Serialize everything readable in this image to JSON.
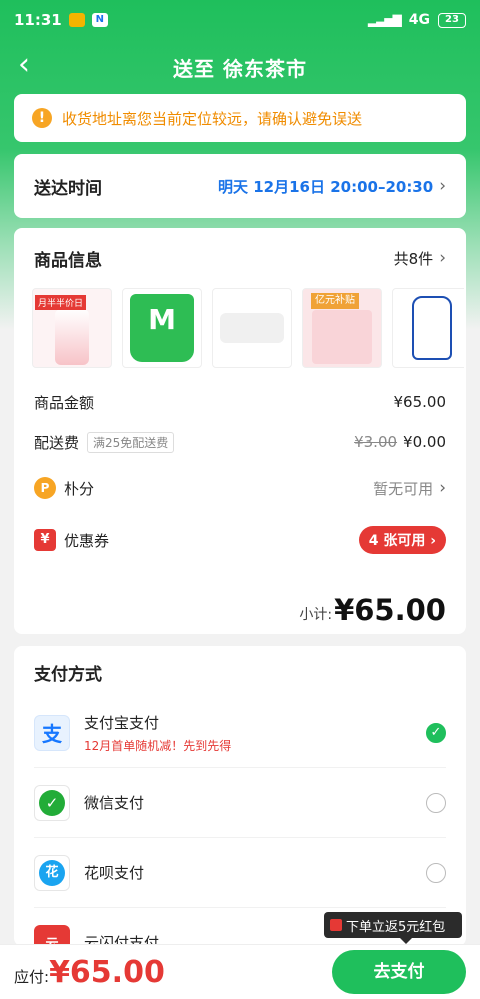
{
  "status_bar": {
    "time": "11:31",
    "network": "4G",
    "battery": "23"
  },
  "nav": {
    "back_icon": "‹",
    "title": "送至 徐东茶市"
  },
  "warning": {
    "icon": "!",
    "text": "收货地址离您当前定位较远，请确认避免误送"
  },
  "delivery": {
    "label": "送达时间",
    "value": "明天 12月16日 20:00–20:30"
  },
  "goods": {
    "title": "商品信息",
    "count": "共8件",
    "thumbs": [
      {
        "tag": "月半半价日"
      },
      {
        "text": "M"
      },
      {},
      {
        "badge": "亿元补贴"
      },
      {}
    ],
    "amount_label": "商品金额",
    "amount": "¥65.00",
    "fee_label": "配送费",
    "fee_tag": "满25免配送费",
    "fee_original": "¥3.00",
    "fee": "¥0.00",
    "points_label": "朴分",
    "points_value": "暂无可用",
    "coupon_label": "优惠券",
    "coupon_icon": "¥",
    "coupon_value": "4 张可用",
    "subtotal_label": "小计:",
    "subtotal": "¥65.00"
  },
  "payment": {
    "title": "支付方式",
    "methods": [
      {
        "name": "支付宝支付",
        "sub": "12月首单随机减！先到先得",
        "selected": true,
        "icon": "支"
      },
      {
        "name": "微信支付",
        "sub": "",
        "selected": false,
        "icon": "✓"
      },
      {
        "name": "花呗支付",
        "sub": "",
        "selected": false,
        "icon": "花"
      },
      {
        "name": "云闪付支付",
        "sub": "",
        "selected": false,
        "icon": "云"
      }
    ]
  },
  "promo": {
    "text": "下单立返5元红包"
  },
  "bottom": {
    "total_label": "应付:",
    "total": "¥65.00",
    "submit": "去支付"
  },
  "colors": {
    "brand_green": "#1fbf5c",
    "price_red": "#e53935",
    "link_blue": "#1a73e8",
    "warn_orange": "#f08c00"
  }
}
